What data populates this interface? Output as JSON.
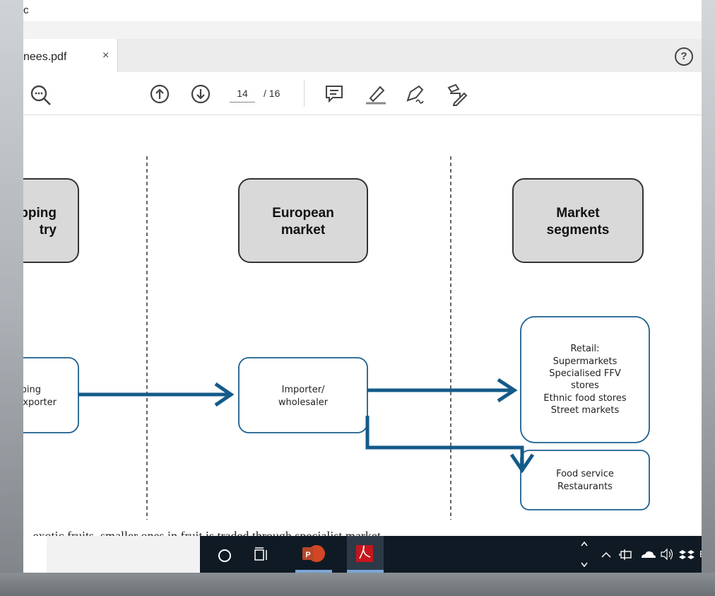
{
  "titlebar": {
    "text": "c"
  },
  "tab": {
    "title": "nees.pdf",
    "close_label": "×"
  },
  "help": {
    "label": "?"
  },
  "toolbar": {
    "page_current": "14",
    "page_total": "/ 16"
  },
  "diagram": {
    "header_left_line1": "pping",
    "header_left_line2": "try",
    "header_mid_line1": "European",
    "header_mid_line2": "market",
    "header_right_line1": "Market",
    "header_right_line2": "segments",
    "node_left_line1": "ping",
    "node_left_line2": "xporter",
    "node_mid_line1": "Importer/",
    "node_mid_line2": "wholesaler",
    "retail_lines": [
      "Retail:",
      "Supermarkets",
      "Specialised FFV",
      "stores",
      "Ethnic food stores",
      "Street markets"
    ],
    "food_lines": [
      "Food service",
      "Restaurants"
    ]
  },
  "caption": {
    "text": "...exotic fruits, smaller ones in fruit is traded through specialist market..."
  },
  "taskbar": {
    "language": "EN",
    "powerpoint_letter": "P"
  },
  "colors": {
    "arrow_blue": "#145a8a",
    "box_grey": "#d9d9d9",
    "node_border": "#1c5f8f"
  }
}
